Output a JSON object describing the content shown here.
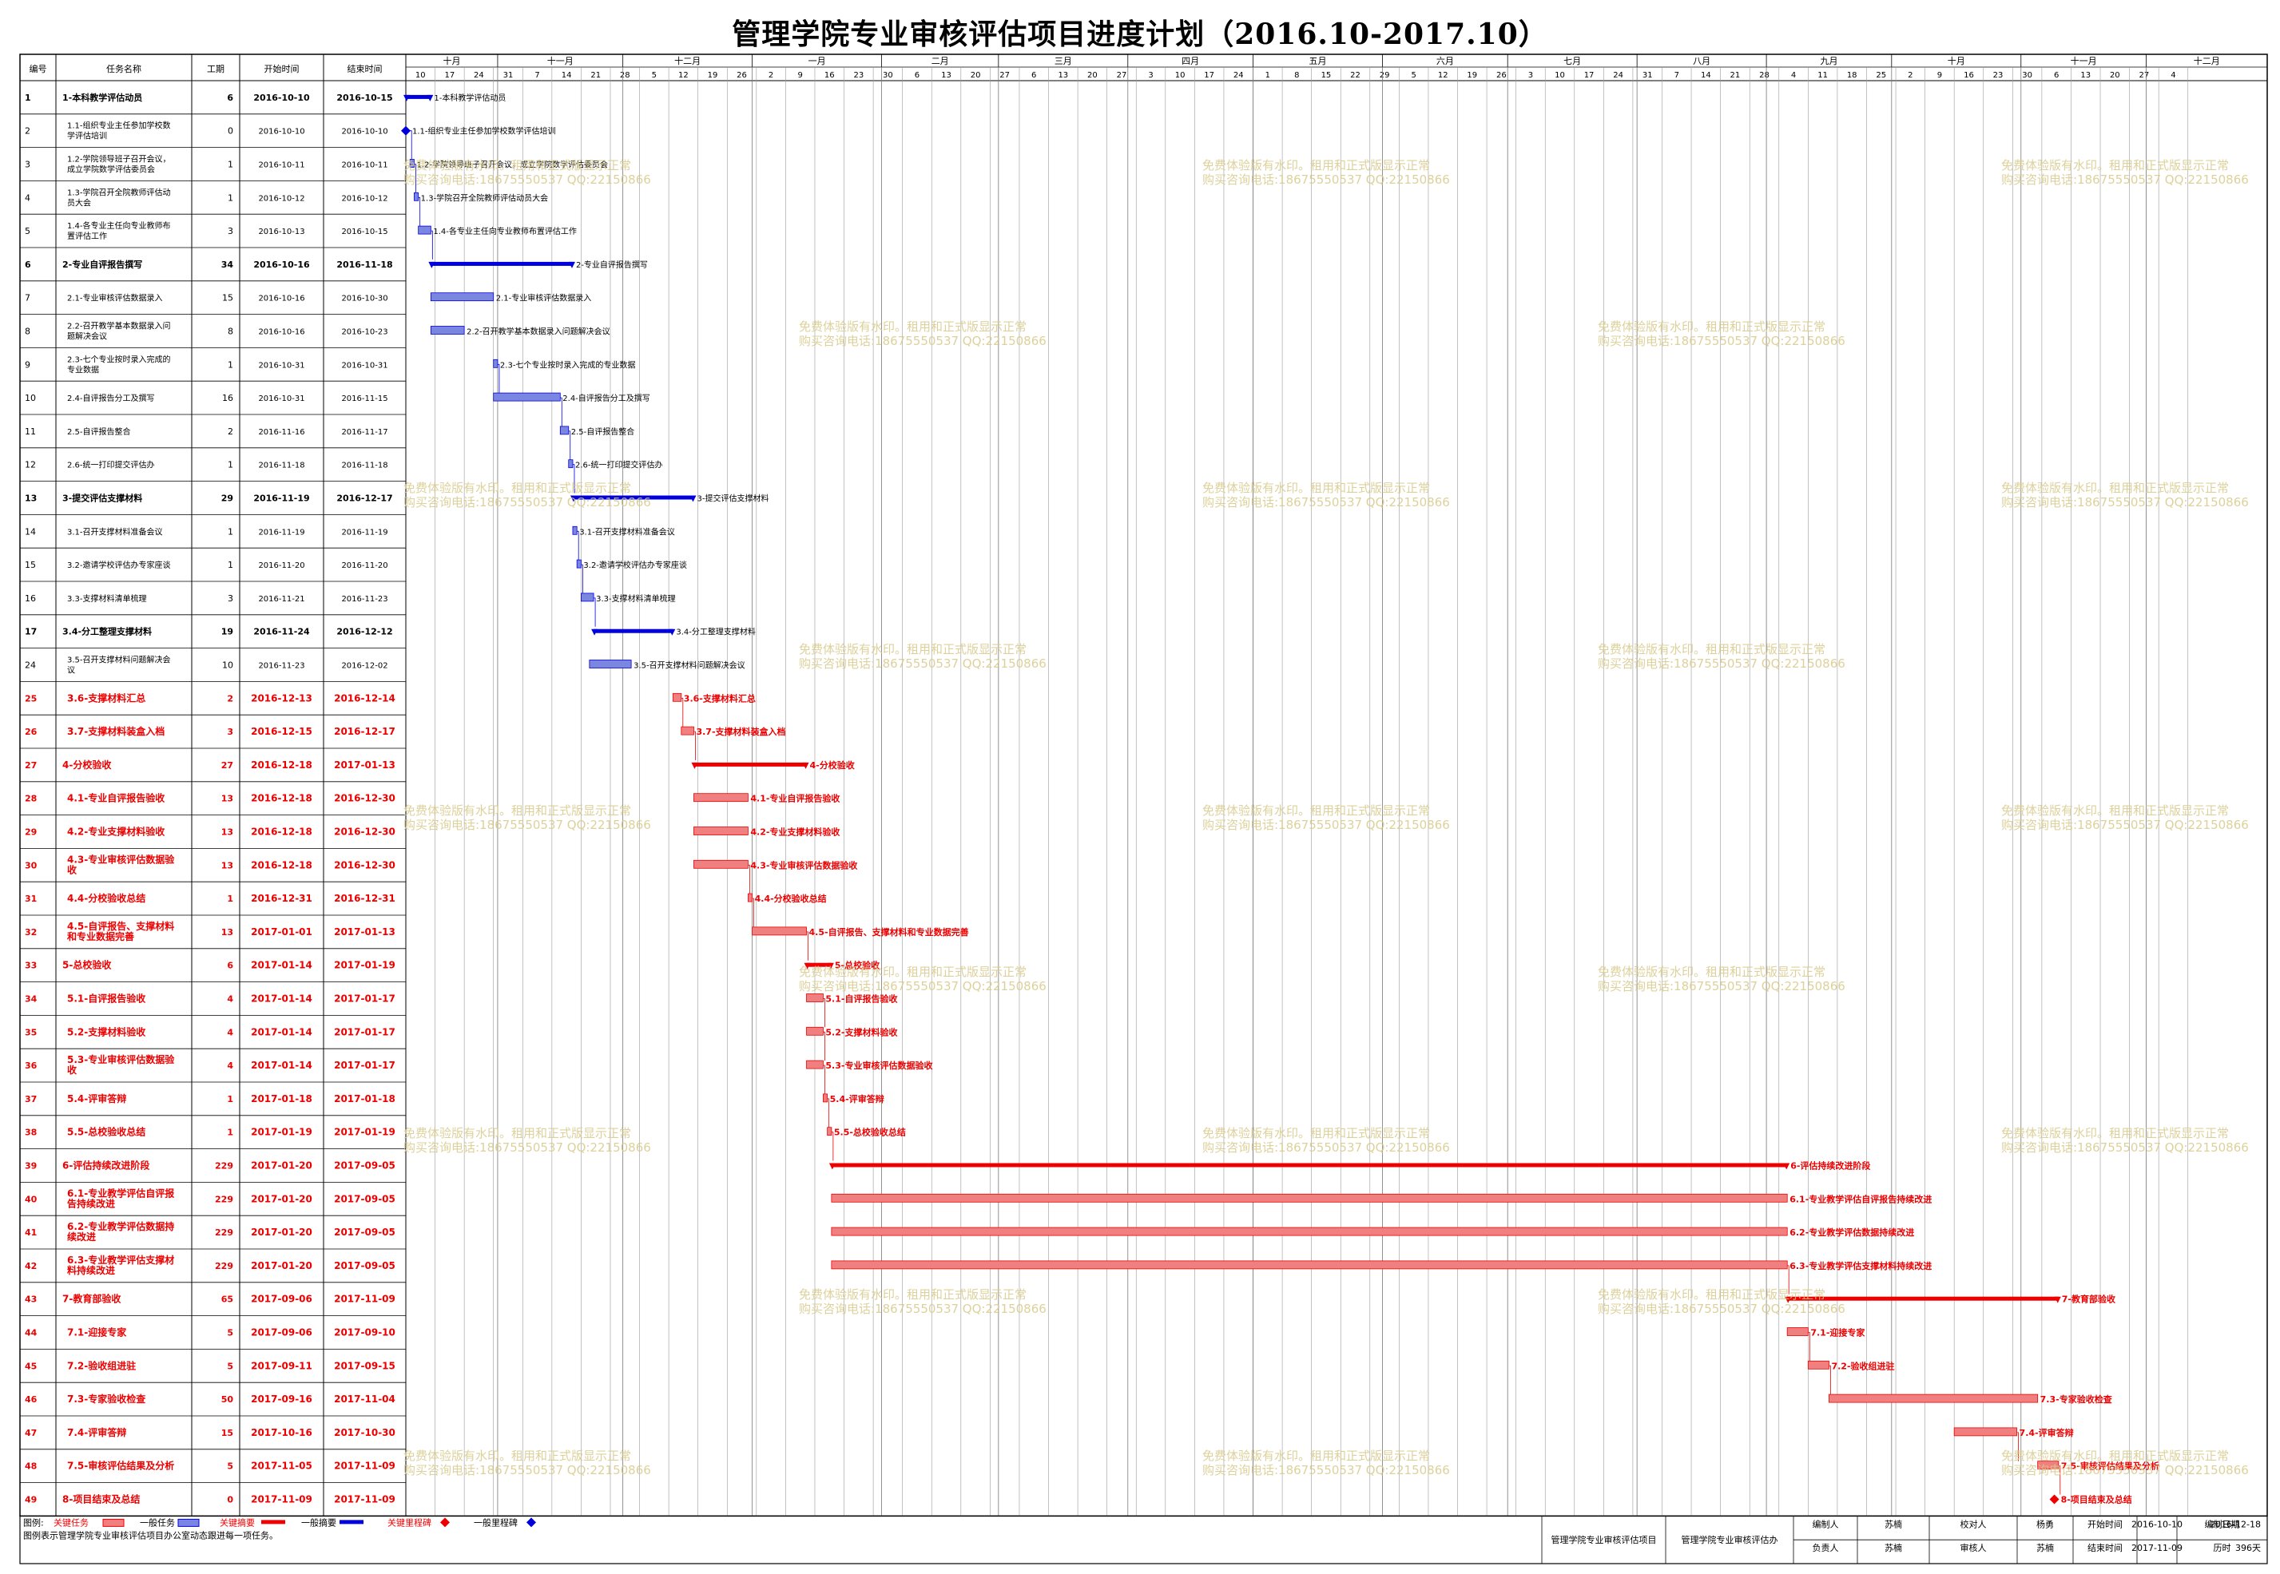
{
  "title": "管理学院专业审核评估项目进度计划（2016.10-2017.10）",
  "columns": {
    "id": "编号",
    "name": "任务名称",
    "duration": "工期",
    "start": "开始时间",
    "end": "结束时间"
  },
  "timeline": {
    "start": "2016-10-10",
    "end": "2017-12-29",
    "months": [
      {
        "label": "十月",
        "days": 22
      },
      {
        "label": "十一月",
        "days": 30
      },
      {
        "label": "十二月",
        "days": 31
      },
      {
        "label": "一月",
        "days": 31
      },
      {
        "label": "二月",
        "days": 28
      },
      {
        "label": "三月",
        "days": 31
      },
      {
        "label": "四月",
        "days": 30
      },
      {
        "label": "五月",
        "days": 31
      },
      {
        "label": "六月",
        "days": 30
      },
      {
        "label": "七月",
        "days": 31
      },
      {
        "label": "八月",
        "days": 31
      },
      {
        "label": "九月",
        "days": 30
      },
      {
        "label": "十月",
        "days": 31
      },
      {
        "label": "十一月",
        "days": 30
      },
      {
        "label": "十二月",
        "days": 29
      }
    ],
    "week_ticks": [
      "10",
      "17",
      "24",
      "31",
      "7",
      "14",
      "21",
      "28",
      "5",
      "12",
      "19",
      "26",
      "2",
      "9",
      "16",
      "23",
      "30",
      "6",
      "13",
      "20",
      "27",
      "6",
      "13",
      "20",
      "27",
      "3",
      "10",
      "17",
      "24",
      "1",
      "8",
      "15",
      "22",
      "29",
      "5",
      "12",
      "19",
      "26",
      "3",
      "10",
      "17",
      "24",
      "31",
      "7",
      "14",
      "21",
      "28",
      "4",
      "11",
      "18",
      "25",
      "2",
      "9",
      "16",
      "23",
      "30",
      "6",
      "13",
      "20",
      "27",
      "4"
    ]
  },
  "tasks": [
    {
      "id": "1",
      "name": "1-本科教学评估动员",
      "dur": "6",
      "start": "2016-10-10",
      "end": "2016-10-15",
      "type": "summary",
      "crit": false,
      "bar": "1-本科教学评估动员"
    },
    {
      "id": "2",
      "name": "1.1-组织专业主任参加学校数学评估培训",
      "dur": "0",
      "start": "2016-10-10",
      "end": "2016-10-10",
      "type": "milestone",
      "crit": false,
      "bar": "1.1-组织专业主任参加学校数学评估培训"
    },
    {
      "id": "3",
      "name": "1.2-学院领导班子召开会议，成立学院数学评估委员会",
      "dur": "1",
      "start": "2016-10-11",
      "end": "2016-10-11",
      "type": "task",
      "crit": false,
      "bar": "1.2-学院领导班子召开会议，成立学院数学评估委员会"
    },
    {
      "id": "4",
      "name": "1.3-学院召开全院教师评估动员大会",
      "dur": "1",
      "start": "2016-10-12",
      "end": "2016-10-12",
      "type": "task",
      "crit": false,
      "bar": "1.3-学院召开全院教师评估动员大会"
    },
    {
      "id": "5",
      "name": "1.4-各专业主任向专业教师布置评估工作",
      "dur": "3",
      "start": "2016-10-13",
      "end": "2016-10-15",
      "type": "task",
      "crit": false,
      "bar": "1.4-各专业主任向专业教师布置评估工作"
    },
    {
      "id": "6",
      "name": "2-专业自评报告撰写",
      "dur": "34",
      "start": "2016-10-16",
      "end": "2016-11-18",
      "type": "summary",
      "crit": false,
      "bar": "2-专业自评报告撰写"
    },
    {
      "id": "7",
      "name": "2.1-专业审核评估数据录入",
      "dur": "15",
      "start": "2016-10-16",
      "end": "2016-10-30",
      "type": "task",
      "crit": false,
      "bar": "2.1-专业审核评估数据录入"
    },
    {
      "id": "8",
      "name": "2.2-召开教学基本数据录入问题解决会议",
      "dur": "8",
      "start": "2016-10-16",
      "end": "2016-10-23",
      "type": "task",
      "crit": false,
      "bar": "2.2-召开教学基本数据录入问题解决会议"
    },
    {
      "id": "9",
      "name": "2.3-七个专业按时录入完成的专业数据",
      "dur": "1",
      "start": "2016-10-31",
      "end": "2016-10-31",
      "type": "task",
      "crit": false,
      "bar": "2.3-七个专业按时录入完成的专业数据"
    },
    {
      "id": "10",
      "name": "2.4-自评报告分工及撰写",
      "dur": "16",
      "start": "2016-10-31",
      "end": "2016-11-15",
      "type": "task",
      "crit": false,
      "bar": "2.4-自评报告分工及撰写"
    },
    {
      "id": "11",
      "name": "2.5-自评报告整合",
      "dur": "2",
      "start": "2016-11-16",
      "end": "2016-11-17",
      "type": "task",
      "crit": false,
      "bar": "2.5-自评报告整合"
    },
    {
      "id": "12",
      "name": "2.6-统一打印提交评估办",
      "dur": "1",
      "start": "2016-11-18",
      "end": "2016-11-18",
      "type": "task",
      "crit": false,
      "bar": "2.6-统一打印提交评估办"
    },
    {
      "id": "13",
      "name": "3-提交评估支撑材料",
      "dur": "29",
      "start": "2016-11-19",
      "end": "2016-12-17",
      "type": "summary",
      "crit": false,
      "bar": "3-提交评估支撑材料"
    },
    {
      "id": "14",
      "name": "3.1-召开支撑材料准备会议",
      "dur": "1",
      "start": "2016-11-19",
      "end": "2016-11-19",
      "type": "task",
      "crit": false,
      "bar": "3.1-召开支撑材料准备会议"
    },
    {
      "id": "15",
      "name": "3.2-邀请学校评估办专家座谈",
      "dur": "1",
      "start": "2016-11-20",
      "end": "2016-11-20",
      "type": "task",
      "crit": false,
      "bar": "3.2-邀请学校评估办专家座谈"
    },
    {
      "id": "16",
      "name": "3.3-支撑材料清单梳理",
      "dur": "3",
      "start": "2016-11-21",
      "end": "2016-11-23",
      "type": "task",
      "crit": false,
      "bar": "3.3-支撑材料清单梳理"
    },
    {
      "id": "17",
      "name": "3.4-分工整理支撑材料",
      "dur": "19",
      "start": "2016-11-24",
      "end": "2016-12-12",
      "type": "summary",
      "crit": false,
      "bar": "3.4-分工整理支撑材料"
    },
    {
      "id": "24",
      "name": "3.5-召开支撑材料问题解决会议",
      "dur": "10",
      "start": "2016-11-23",
      "end": "2016-12-02",
      "type": "task",
      "crit": false,
      "bar": "3.5-召开支撑材料问题解决会议"
    },
    {
      "id": "25",
      "name": "3.6-支撑材料汇总",
      "dur": "2",
      "start": "2016-12-13",
      "end": "2016-12-14",
      "type": "task",
      "crit": true,
      "bar": "3.6-支撑材料汇总"
    },
    {
      "id": "26",
      "name": "3.7-支撑材料装盒入档",
      "dur": "3",
      "start": "2016-12-15",
      "end": "2016-12-17",
      "type": "task",
      "crit": true,
      "bar": "3.7-支撑材料装盒入档"
    },
    {
      "id": "27",
      "name": "4-分校验收",
      "dur": "27",
      "start": "2016-12-18",
      "end": "2017-01-13",
      "type": "summary",
      "crit": true,
      "bar": "4-分校验收"
    },
    {
      "id": "28",
      "name": "4.1-专业自评报告验收",
      "dur": "13",
      "start": "2016-12-18",
      "end": "2016-12-30",
      "type": "task",
      "crit": true,
      "bar": "4.1-专业自评报告验收"
    },
    {
      "id": "29",
      "name": "4.2-专业支撑材料验收",
      "dur": "13",
      "start": "2016-12-18",
      "end": "2016-12-30",
      "type": "task",
      "crit": true,
      "bar": "4.2-专业支撑材料验收"
    },
    {
      "id": "30",
      "name": "4.3-专业审核评估数据验收",
      "dur": "13",
      "start": "2016-12-18",
      "end": "2016-12-30",
      "type": "task",
      "crit": true,
      "bar": "4.3-专业审核评估数据验收"
    },
    {
      "id": "31",
      "name": "4.4-分校验收总结",
      "dur": "1",
      "start": "2016-12-31",
      "end": "2016-12-31",
      "type": "task",
      "crit": true,
      "bar": "4.4-分校验收总结"
    },
    {
      "id": "32",
      "name": "4.5-自评报告、支撑材料和专业数据完善",
      "dur": "13",
      "start": "2017-01-01",
      "end": "2017-01-13",
      "type": "task",
      "crit": true,
      "bar": "4.5-自评报告、支撑材料和专业数据完善"
    },
    {
      "id": "33",
      "name": "5-总校验收",
      "dur": "6",
      "start": "2017-01-14",
      "end": "2017-01-19",
      "type": "summary",
      "crit": true,
      "bar": "5-总校验收"
    },
    {
      "id": "34",
      "name": "5.1-自评报告验收",
      "dur": "4",
      "start": "2017-01-14",
      "end": "2017-01-17",
      "type": "task",
      "crit": true,
      "bar": "5.1-自评报告验收"
    },
    {
      "id": "35",
      "name": "5.2-支撑材料验收",
      "dur": "4",
      "start": "2017-01-14",
      "end": "2017-01-17",
      "type": "task",
      "crit": true,
      "bar": "5.2-支撑材料验收"
    },
    {
      "id": "36",
      "name": "5.3-专业审核评估数据验收",
      "dur": "4",
      "start": "2017-01-14",
      "end": "2017-01-17",
      "type": "task",
      "crit": true,
      "bar": "5.3-专业审核评估数据验收"
    },
    {
      "id": "37",
      "name": "5.4-评审答辩",
      "dur": "1",
      "start": "2017-01-18",
      "end": "2017-01-18",
      "type": "task",
      "crit": true,
      "bar": "5.4-评审答辩"
    },
    {
      "id": "38",
      "name": "5.5-总校验收总结",
      "dur": "1",
      "start": "2017-01-19",
      "end": "2017-01-19",
      "type": "task",
      "crit": true,
      "bar": "5.5-总校验收总结"
    },
    {
      "id": "39",
      "name": "6-评估持续改进阶段",
      "dur": "229",
      "start": "2017-01-20",
      "end": "2017-09-05",
      "type": "summary",
      "crit": true,
      "bar": "6-评估持续改进阶段"
    },
    {
      "id": "40",
      "name": "6.1-专业教学评估自评报告持续改进",
      "dur": "229",
      "start": "2017-01-20",
      "end": "2017-09-05",
      "type": "task",
      "crit": true,
      "bar": "6.1-专业教学评估自评报告持续改进"
    },
    {
      "id": "41",
      "name": "6.2-专业教学评估数据持续改进",
      "dur": "229",
      "start": "2017-01-20",
      "end": "2017-09-05",
      "type": "task",
      "crit": true,
      "bar": "6.2-专业教学评估数据持续改进"
    },
    {
      "id": "42",
      "name": "6.3-专业教学评估支撑材料持续改进",
      "dur": "229",
      "start": "2017-01-20",
      "end": "2017-09-05",
      "type": "task",
      "crit": true,
      "bar": "6.3-专业教学评估支撑材料持续改进"
    },
    {
      "id": "43",
      "name": "7-教育部验收",
      "dur": "65",
      "start": "2017-09-06",
      "end": "2017-11-09",
      "type": "summary",
      "crit": true,
      "bar": "7-教育部验收"
    },
    {
      "id": "44",
      "name": "7.1-迎接专家",
      "dur": "5",
      "start": "2017-09-06",
      "end": "2017-09-10",
      "type": "task",
      "crit": true,
      "bar": "7.1-迎接专家"
    },
    {
      "id": "45",
      "name": "7.2-验收组进驻",
      "dur": "5",
      "start": "2017-09-11",
      "end": "2017-09-15",
      "type": "task",
      "crit": true,
      "bar": "7.2-验收组进驻"
    },
    {
      "id": "46",
      "name": "7.3-专家验收检查",
      "dur": "50",
      "start": "2017-09-16",
      "end": "2017-11-04",
      "type": "task",
      "crit": true,
      "bar": "7.3-专家验收检查"
    },
    {
      "id": "47",
      "name": "7.4-评审答辩",
      "dur": "15",
      "start": "2017-10-16",
      "end": "2017-10-30",
      "type": "task",
      "crit": true,
      "bar": "7.4-评审答辩"
    },
    {
      "id": "48",
      "name": "7.5-审核评估结果及分析",
      "dur": "5",
      "start": "2017-11-05",
      "end": "2017-11-09",
      "type": "task",
      "crit": true,
      "bar": "7.5-审核评估结果及分析"
    },
    {
      "id": "49",
      "name": "8-项目结束及总结",
      "dur": "0",
      "start": "2017-11-09",
      "end": "2017-11-09",
      "type": "milestone",
      "crit": true,
      "bar": "8-项目结束及总结"
    }
  ],
  "legend": {
    "label": "图例:",
    "items": [
      "关键任务",
      "一般任务",
      "关键摘要",
      "一般摘要",
      "关键里程碑",
      "一般里程碑"
    ],
    "note": "图例表示管理学院专业审核评估项目办公室动态跟进每一项任务。"
  },
  "info": {
    "project": "管理学院专业审核评估项目",
    "office": "管理学院专业审核评估办",
    "editor_label": "编制人",
    "editor": "苏楠",
    "checker_label": "校对人",
    "checker": "杨勇",
    "start_label": "开始时间",
    "start": "2016-10-10",
    "date_label": "编制日期",
    "date": "2016-12-18",
    "owner_label": "负责人",
    "owner": "苏楠",
    "reviewer_label": "审核人",
    "reviewer": "苏楠",
    "end_label": "结束时间",
    "end": "2017-11-09",
    "span_label": "历时",
    "span": "396天"
  },
  "watermark": {
    "line1": "免费体验版有水印。租用和正式版显示正常",
    "line2": "购买咨询电话:18675550537 QQ:22150866"
  },
  "colors": {
    "critical": "#ee0000",
    "critical_fill": "#f08080",
    "normal": "#0000dd",
    "normal_fill": "#7b86e0",
    "grid": "#9a9a9a"
  }
}
